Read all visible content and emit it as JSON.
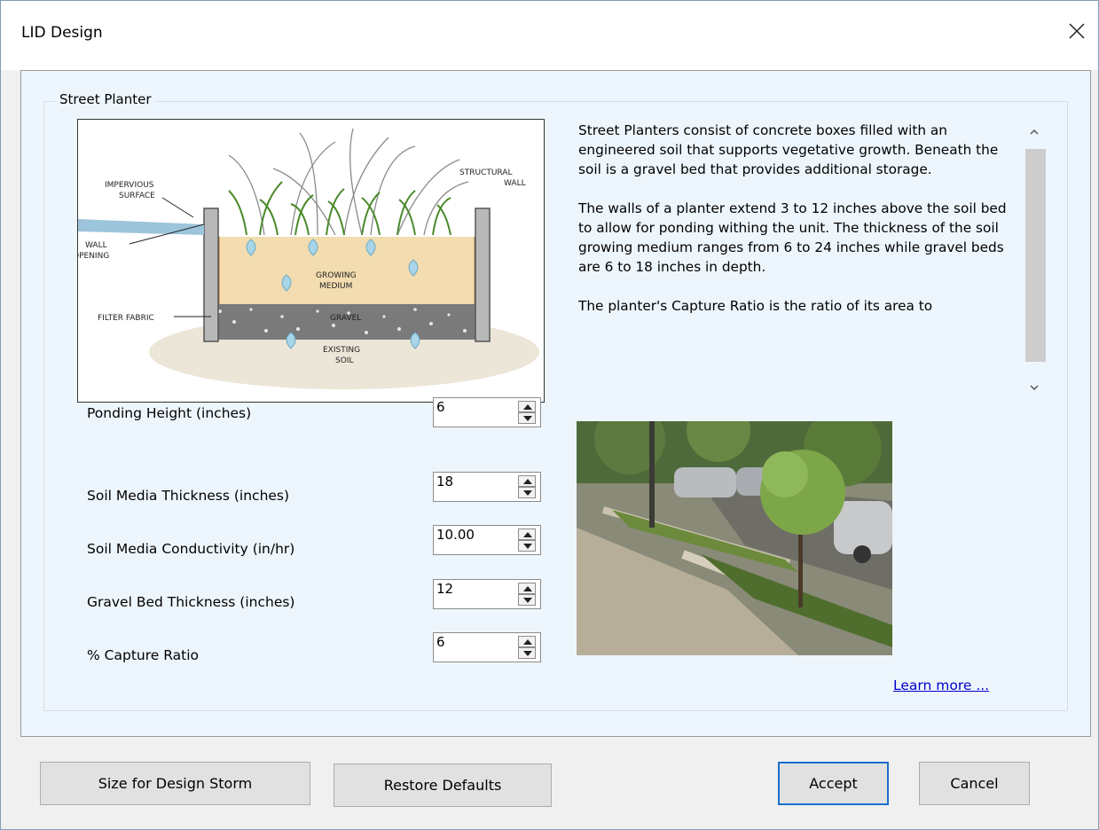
{
  "window": {
    "title": "LID Design"
  },
  "group": {
    "title": "Street Planter"
  },
  "diagram": {
    "labels": {
      "impervious_surface": [
        "IMPERVIOUS",
        "SURFACE"
      ],
      "structural_wall": [
        "STRUCTURAL",
        "WALL"
      ],
      "wall_opening": [
        "WALL",
        "OPENING"
      ],
      "growing_medium": [
        "GROWING",
        "MEDIUM"
      ],
      "filter_fabric": "FILTER FABRIC",
      "gravel": "GRAVEL",
      "existing_soil": [
        "EXISTING",
        "SOIL"
      ]
    }
  },
  "description": {
    "paragraphs": [
      "Street Planters consist of concrete boxes filled with an engineered soil that supports vegetative growth. Beneath the soil is a gravel bed that provides additional storage.",
      "The walls of a planter extend 3 to 12 inches above the soil bed to allow for ponding withing the unit. The thickness of the soil growing medium ranges from 6 to 24 inches while gravel beds are 6 to 18 inches in depth.",
      "The planter's Capture Ratio is the ratio of its area to"
    ]
  },
  "params": [
    {
      "label": "Ponding Height (inches)",
      "value": "6"
    },
    {
      "label": "Soil Media Thickness (inches)",
      "value": "18"
    },
    {
      "label": "Soil Media Conductivity (in/hr)",
      "value": "10.00"
    },
    {
      "label": "Gravel Bed Thickness (inches)",
      "value": "12"
    },
    {
      "label": "% Capture Ratio",
      "value": "6"
    }
  ],
  "learn_more": "Learn more ...",
  "buttons": {
    "size_for_design_storm": "Size for Design Storm",
    "restore_defaults": "Restore Defaults",
    "accept": "Accept",
    "cancel": "Cancel"
  }
}
